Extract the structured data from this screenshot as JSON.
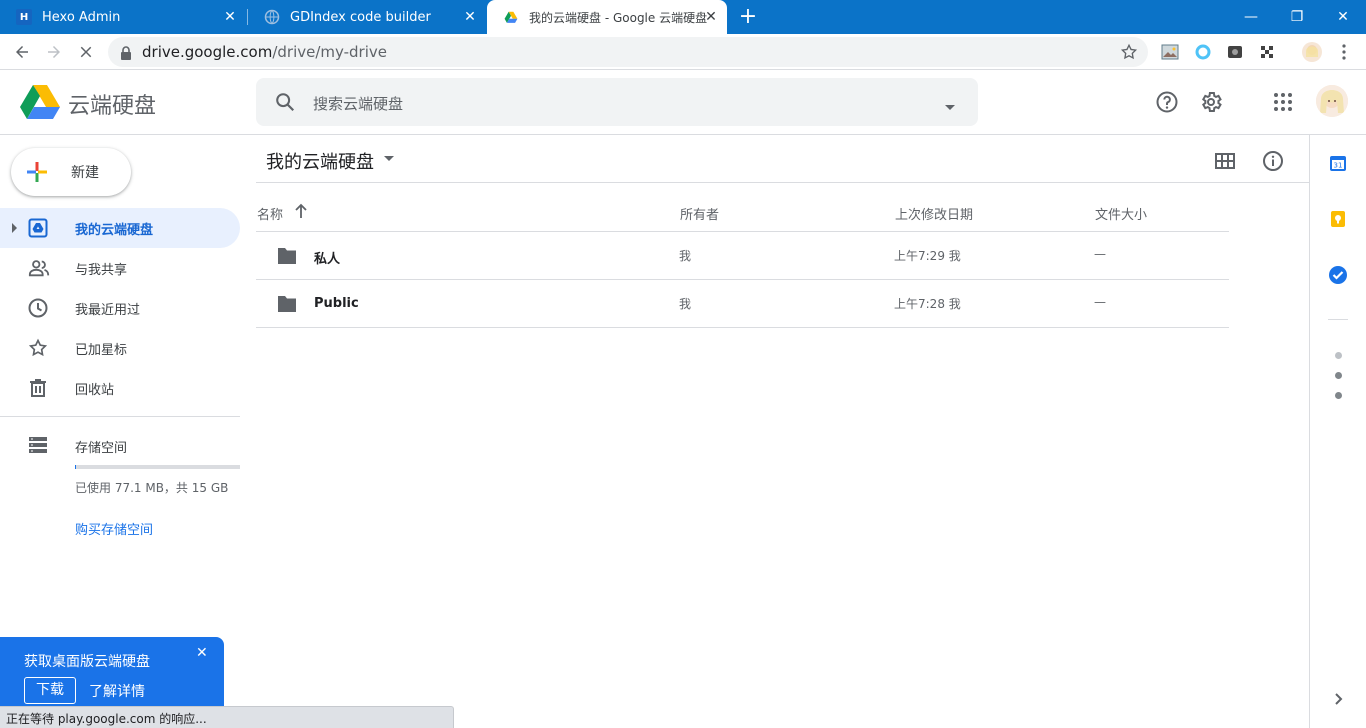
{
  "browser": {
    "tabs": [
      {
        "title": "Hexo Admin",
        "favicon": "H"
      },
      {
        "title": "GDIndex code builder",
        "favicon": "globe-icon"
      },
      {
        "title": "我的云端硬盘 - Google 云端硬盘",
        "favicon": "drive-icon"
      }
    ],
    "url_host": "drive.google.com",
    "url_path": "/drive/my-drive"
  },
  "app": {
    "title": "云端硬盘",
    "search_placeholder": "搜索云端硬盘"
  },
  "sidebar": {
    "new_label": "新建",
    "items": [
      {
        "label": "我的云端硬盘",
        "icon": "my-drive-icon",
        "active": true
      },
      {
        "label": "与我共享",
        "icon": "shared-icon"
      },
      {
        "label": "我最近用过",
        "icon": "recent-icon"
      },
      {
        "label": "已加星标",
        "icon": "star-icon"
      },
      {
        "label": "回收站",
        "icon": "trash-icon"
      }
    ],
    "storage_label": "存储空间",
    "storage_used_text": "已使用 77.1 MB，共 15 GB",
    "storage_fraction": 0.005,
    "buy_storage_label": "购买存储空间"
  },
  "main": {
    "breadcrumb": "我的云端硬盘",
    "columns": {
      "name": "名称",
      "owner": "所有者",
      "modified": "上次修改日期",
      "size": "文件大小"
    },
    "rows": [
      {
        "name": "私人",
        "owner": "我",
        "modified": "上午7:29 我",
        "size": "—"
      },
      {
        "name": "Public",
        "owner": "我",
        "modified": "上午7:28 我",
        "size": "—"
      }
    ]
  },
  "promo": {
    "title": "获取桌面版云端硬盘",
    "download_label": "下载",
    "learn_more_label": "了解详情"
  },
  "status_bar": "正在等待 play.google.com 的响应..."
}
